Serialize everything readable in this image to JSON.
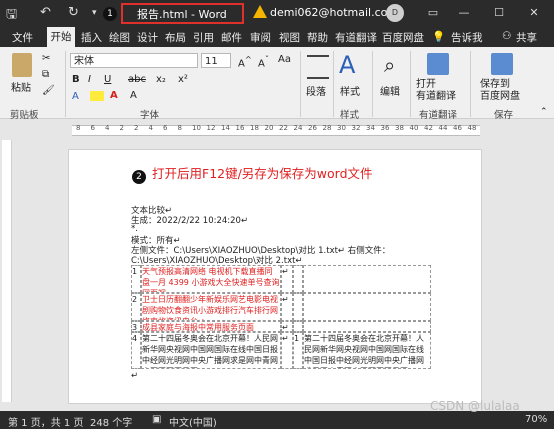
{
  "window": {
    "title": "报告.html  -  Word",
    "account": "demi062@hotmail.com",
    "avatar": "D",
    "callout1": "1",
    "callout2": "2",
    "controls": {
      "restore": "▭",
      "minimize": "—",
      "maximize": "☐",
      "close": "✕"
    }
  },
  "tabs": {
    "file": "文件",
    "home": "开始",
    "insert": "插入",
    "draw": "绘图",
    "design": "设计",
    "layout": "布局",
    "references": "引用",
    "mailings": "邮件",
    "review": "审阅",
    "view": "视图",
    "help": "帮助",
    "translate": "有道翻译",
    "baidu": "百度网盘",
    "tellme": "告诉我",
    "share": "共享"
  },
  "ribbon": {
    "paste": "粘贴",
    "clipboard": "剪贴板",
    "font_name": "宋体",
    "font_size": "11",
    "font_group": "字体",
    "font_buttons": [
      "B",
      "I",
      "U",
      "abc",
      "x₂",
      "x²"
    ],
    "paragraph": "段落",
    "styles": "样式",
    "editing": "编辑",
    "open_translate": "打开\n有道翻译",
    "translate_group": "有道翻译",
    "save_baidu": "保存到\n百度网盘",
    "save_group": "保存"
  },
  "ruler": {
    "ticks": [
      "8",
      "6",
      "4",
      "2",
      "2",
      "4",
      "6",
      "8",
      "10",
      "12",
      "14",
      "16",
      "18",
      "20",
      "22",
      "24",
      "26",
      "28",
      "30",
      "32",
      "34",
      "36",
      "38",
      "40",
      "42",
      "44",
      "46",
      "48"
    ]
  },
  "document": {
    "note": "打开后用F12键/另存为保存为word文件",
    "line1": "文本比较↵",
    "line2": "生成：2022/2/22 10:24:20↵",
    "line3": "*.",
    "line4": "模式：所有↵",
    "line5": "左侧文件：C:\\Users\\XIAOZHUO\\Desktop\\对比 1.txt↵  右侧文件：",
    "line6": "C:\\Users\\XIAOZHUO\\Desktop\\对比 2.txt↵",
    "rows": [
      {
        "num": "1",
        "left": "天气预报高清网络  电视机下载直播同盘一月 4399 小游戏大全快速单号查询网页视",
        "red": true,
        "mark": "↵"
      },
      {
        "num": "2",
        "left": "卫士日历翻翻少年新娱乐网艺电影电视剧购物饮食资讯小游戏排行汽车排行网络事故资讯电台↵",
        "red": true,
        "mark": "↵"
      },
      {
        "num": "3",
        "left": "成县家庭与海报中常用服务页面",
        "red": true,
        "mark": "↵"
      },
      {
        "num": "4",
        "left": "第二十四届冬奥会在北京开幕！人民网新华网央视网中国网国际在线中国日报中经网光明网中央广播网求是网中青网中国军网网易网↵",
        "red": false,
        "mark": "↵"
      }
    ],
    "right_num": "1",
    "right_text": "第二十四届冬奥会在北京开幕！人民网新华网央视网中国网国际在线中国日报中经网光明网中央广播网求是网中青网中国军网网易网↵"
  },
  "status": {
    "page": "第 1 页，共 1 页",
    "words": "248 个字",
    "lang": "中文(中国)",
    "zoom": "70%",
    "watermark": "CSDN @lulalaa"
  }
}
